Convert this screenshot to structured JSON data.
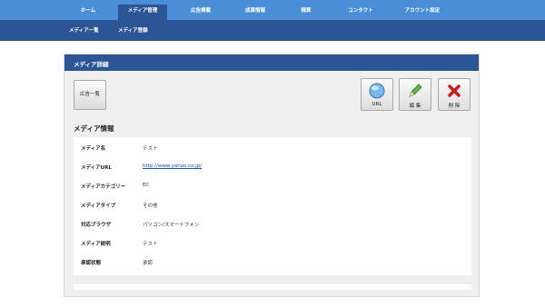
{
  "top_nav": {
    "tabs": [
      {
        "label": "ホーム",
        "active": false
      },
      {
        "label": "メディア管理",
        "active": true
      },
      {
        "label": "広告掲載",
        "active": false
      },
      {
        "label": "成果情報",
        "active": false
      },
      {
        "label": "精算",
        "active": false
      },
      {
        "label": "コンタクト",
        "active": false
      },
      {
        "label": "アカウント設定",
        "active": false
      }
    ]
  },
  "sub_nav": {
    "items": [
      {
        "label": "メディア一覧"
      },
      {
        "label": "メディア登録"
      }
    ]
  },
  "panel": {
    "title": "メディア詳細",
    "ad_list_button": "広告一覧",
    "actions": {
      "url_label": "URL",
      "edit_label": "編 集",
      "delete_label": "削 除"
    }
  },
  "media_info": {
    "heading": "メディア情報",
    "rows": [
      {
        "key": "メディア名",
        "value": "テスト"
      },
      {
        "key": "メディアURL",
        "value": "http://www.yahoo.co.jp/"
      },
      {
        "key": "メディアカテゴリー",
        "value": "EC"
      },
      {
        "key": "メディアタイプ",
        "value": "その他"
      },
      {
        "key": "対応ブラウザ",
        "value": "パソコン/スマートフォン"
      },
      {
        "key": "メディア説明",
        "value": "テスト"
      },
      {
        "key": "承認状態",
        "value": "承認"
      }
    ]
  },
  "colors": {
    "top_nav": "#4a8fd6",
    "dark_blue": "#2c5596",
    "panel_bg": "#efefef",
    "link": "#1a4fb0",
    "delete_red": "#c81e1e",
    "edit_green": "#3a9a2a"
  }
}
